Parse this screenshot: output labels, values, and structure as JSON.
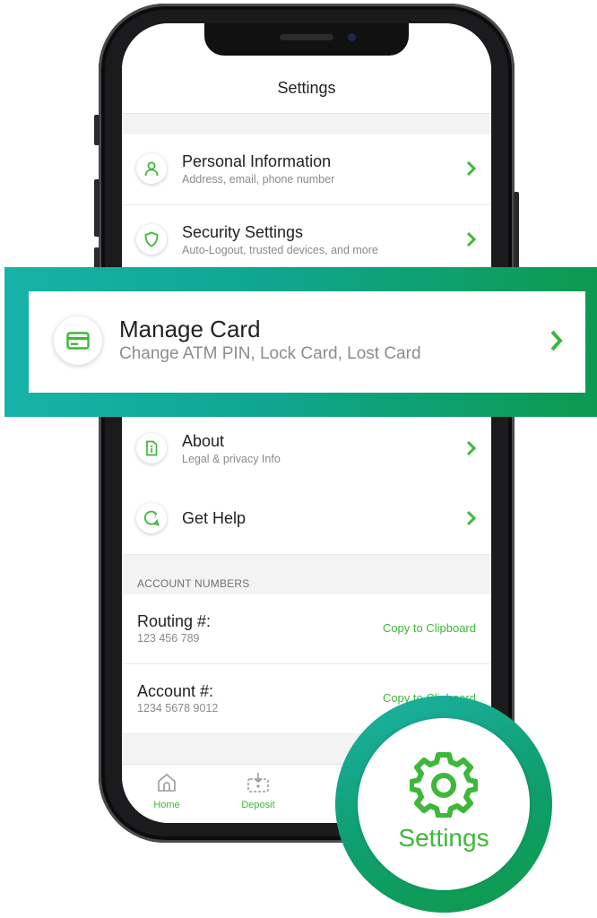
{
  "header": {
    "title": "Settings"
  },
  "settings_rows": [
    {
      "icon": "person-icon",
      "primary": "Personal Information",
      "secondary": "Address, email, phone number"
    },
    {
      "icon": "shield-icon",
      "primary": "Security Settings",
      "secondary": "Auto-Logout, trusted devices, and more"
    },
    {
      "icon": "info-document-icon",
      "primary": "About",
      "secondary": "Legal & privacy Info"
    },
    {
      "icon": "chat-help-icon",
      "primary": "Get Help",
      "secondary": ""
    }
  ],
  "highlight": {
    "icon": "card-icon",
    "primary": "Manage Card",
    "secondary": "Change ATM PIN, Lock Card, Lost Card"
  },
  "account_section": {
    "label": "ACCOUNT NUMBERS",
    "rows": [
      {
        "label": "Routing #:",
        "number": "123 456 789",
        "action": "Copy to Clipboard"
      },
      {
        "label": "Account #:",
        "number": "1234 5678 9012",
        "action": "Copy to Clipboard"
      }
    ]
  },
  "tabbar": {
    "tabs": [
      {
        "icon": "home-icon",
        "label": "Home"
      },
      {
        "icon": "deposit-icon",
        "label": "Deposit"
      }
    ]
  },
  "badge": {
    "icon": "gear-icon",
    "label": "Settings"
  },
  "colors": {
    "accent_green": "#3db83a",
    "teal": "#16b3a8",
    "dark_green": "#0d9a4f"
  }
}
